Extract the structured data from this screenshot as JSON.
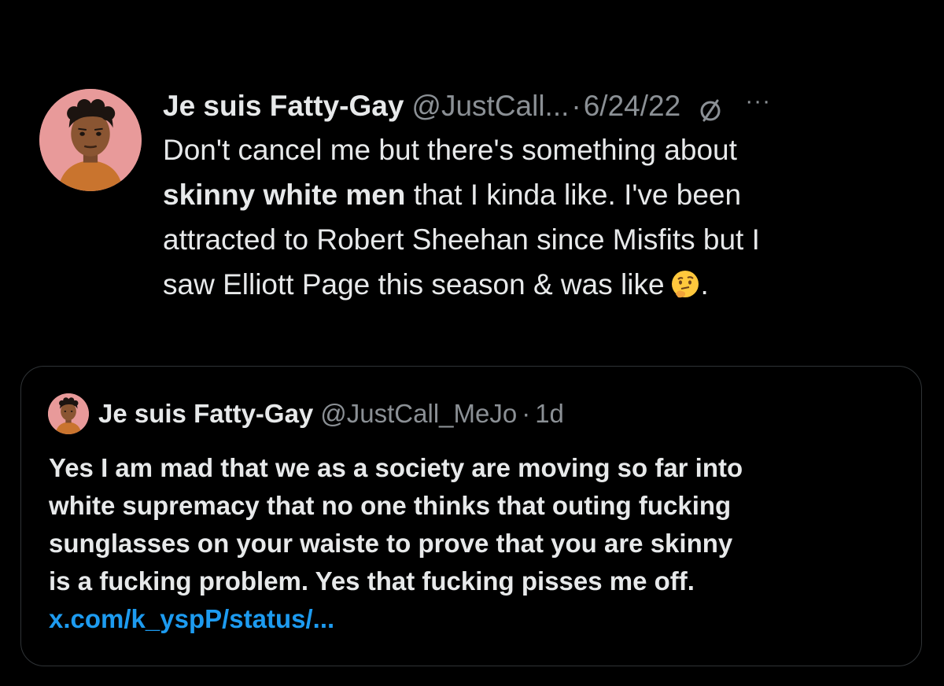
{
  "colors": {
    "background": "#000000",
    "text": "#e7e9ea",
    "muted": "#8b9095",
    "link": "#1d9bf0",
    "border": "#2f3336",
    "avatar_bg": "#e89a9a"
  },
  "tweet": {
    "display_name": "Je suis Fatty-Gay",
    "handle": "@JustCall...",
    "separator": "·",
    "date": "6/24/22",
    "status_icon": "slashed-circle-icon",
    "more_icon": "more-options-icon",
    "more_glyph": "···",
    "text_lines": [
      {
        "text": "Don't cancel me but there's something about"
      },
      {
        "bold": "skinny white men",
        "text": " that I kinda like. I've been"
      },
      {
        "text": "attracted to Robert Sheehan since Misfits but I"
      },
      {
        "text": "saw Elliott Page this season & was like",
        "emoji": "thinking-face-emoji",
        "tail": "."
      }
    ]
  },
  "quoted_tweet": {
    "display_name": "Je suis Fatty-Gay",
    "handle": "@JustCall_MeJo",
    "separator": "·",
    "date": "1d",
    "text_lines": [
      "Yes I am mad that we as a society are moving so far into",
      "white supremacy that no one thinks that outing fucking",
      "sunglasses on your waiste to prove that you are skinny",
      "is a fucking problem. Yes that fucking pisses me off."
    ],
    "link": "x.com/k_yspP/status/..."
  }
}
